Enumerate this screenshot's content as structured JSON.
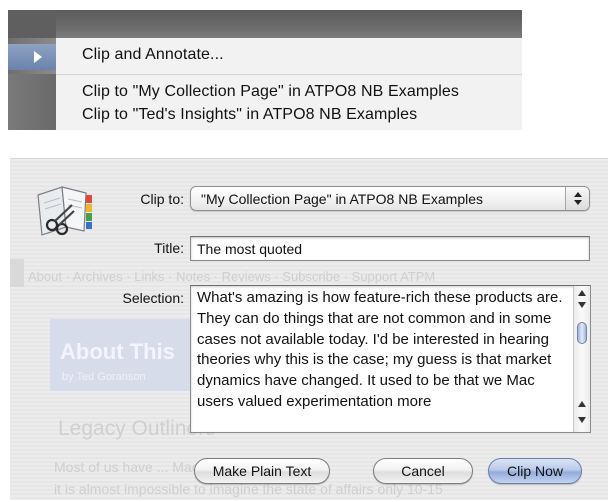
{
  "context_menu": {
    "items": [
      {
        "label": "Clip and Annotate...",
        "has_submenu": true
      },
      {
        "label": "Clip to \"My Collection Page\" in ATPO8 NB Examples"
      },
      {
        "label": "Clip to \"Ted's Insights\" in ATPO8 NB Examples"
      }
    ]
  },
  "dialog": {
    "clip_to_label": "Clip to:",
    "clip_to_value": "\"My Collection Page\" in ATPO8 NB Examples",
    "title_label": "Title:",
    "title_value": "The most quoted",
    "selection_label": "Selection:",
    "selection_text": "What's amazing is how feature-rich these products are. They can do things that are not common and in some cases not available today. I'd be interested in hearing theories why this is the case; my guess is that market dynamics have changed. It used to be that we Mac users valued experimentation more",
    "buttons": {
      "plain": "Make Plain Text",
      "cancel": "Cancel",
      "clip": "Clip Now"
    },
    "background_page": {
      "nav": "About · Archives · Links · Notes · Reviews · Subscribe · Support ATPM",
      "hero_title": "About This",
      "hero_subtitle": "by Ted Goranson",
      "heading": "Legacy Outliners",
      "para1": "Most of us have ...  Mac",
      "para2": "it is almost impossible to imagine the state of affairs only 10-15"
    }
  },
  "colors": {
    "selected_item_highlight": "#6b83ac",
    "default_button": "#93acdb",
    "dialog_background": "#ececec"
  }
}
